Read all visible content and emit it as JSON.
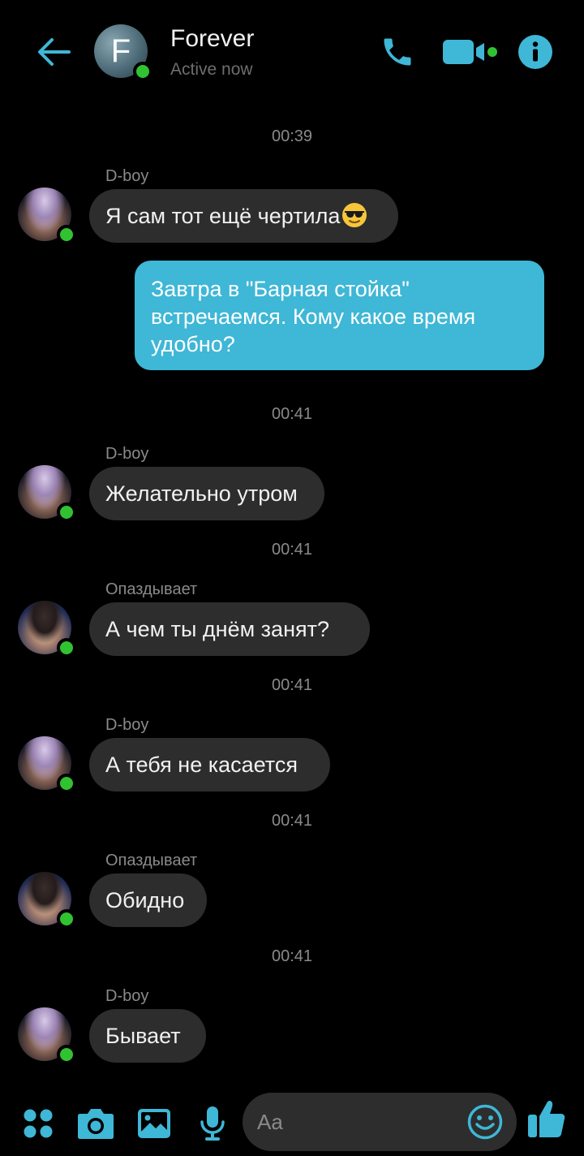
{
  "header": {
    "avatar_letter": "F",
    "title": "Forever",
    "subtitle": "Active now"
  },
  "messages": {
    "ts1": "00:39",
    "m1_sender": "D-boy",
    "m1_text": "Я сам тот ещё чертила",
    "m2_text": "Завтра в \"Барная стойка\" встречаемся. Кому какое время удобно?",
    "ts2": "00:41",
    "m3_sender": "D-boy",
    "m3_text": "Желательно утром",
    "ts3": "00:41",
    "m4_sender": "Опаздывает",
    "m4_text": "А чем ты днём занят?",
    "ts4": "00:41",
    "m5_sender": "D-boy",
    "m5_text": "А тебя не касается",
    "ts5": "00:41",
    "m6_sender": "Опаздывает",
    "m6_text": "Обидно",
    "ts6": "00:41",
    "m7_sender": "D-boy",
    "m7_text": "Бывает"
  },
  "composer": {
    "placeholder": "Aa"
  },
  "icons": {
    "back": "arrow-left-icon",
    "call": "phone-icon",
    "video": "video-camera-icon",
    "info": "info-icon",
    "menu": "four-dots-icon",
    "camera": "camera-icon",
    "gallery": "image-icon",
    "mic": "microphone-icon",
    "emoji": "smiley-icon",
    "like": "thumbs-up-icon",
    "message_emoji": "sunglasses-emoji"
  },
  "colors": {
    "accent": "#3fb7d6",
    "online": "#31c231",
    "incoming_bubble": "#2d2d2d",
    "background": "#000000"
  }
}
